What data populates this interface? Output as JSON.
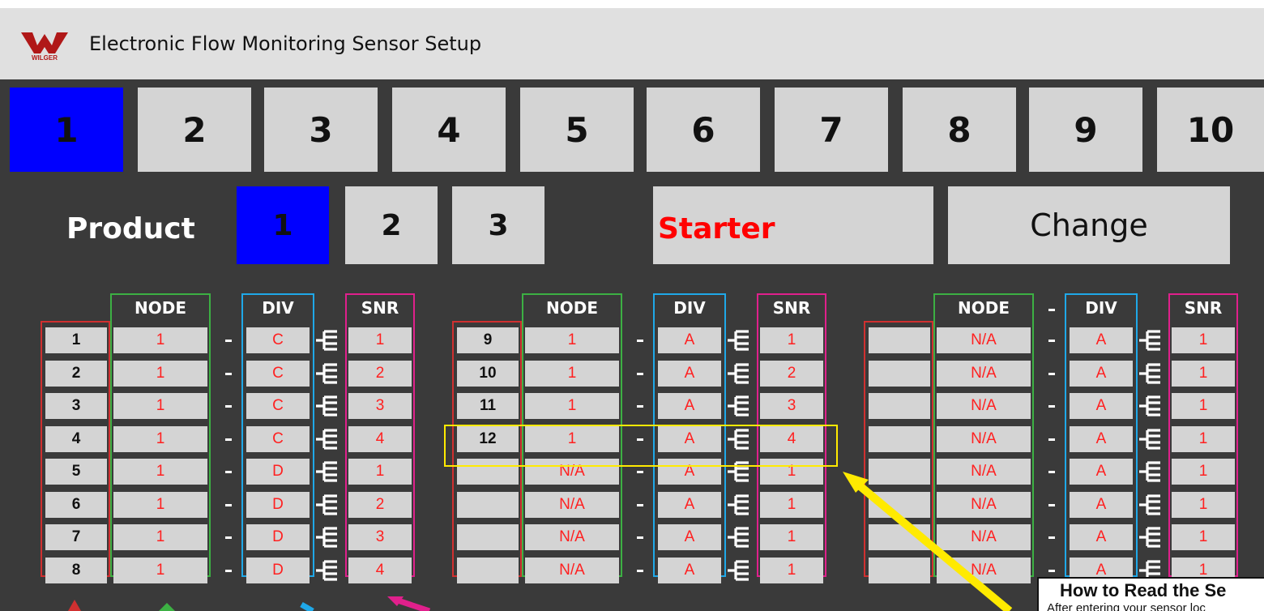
{
  "header": {
    "title": "Electronic Flow Monitoring Sensor Setup",
    "logo_text": "WILGER"
  },
  "tabs": [
    "1",
    "2",
    "3",
    "4",
    "5",
    "6",
    "7",
    "8",
    "9",
    "10"
  ],
  "active_tab": 1,
  "product": {
    "label": "Product",
    "buttons": [
      "1",
      "2",
      "3"
    ],
    "active": 1,
    "name": "Starter",
    "name_color": "#ff0000",
    "change_label": "Change"
  },
  "columns": {
    "node": "NODE",
    "div": "DIV",
    "snr": "SNR"
  },
  "groups": [
    {
      "rows": [
        {
          "row": "1",
          "node": "1",
          "div": "C",
          "snr": "1"
        },
        {
          "row": "2",
          "node": "1",
          "div": "C",
          "snr": "2"
        },
        {
          "row": "3",
          "node": "1",
          "div": "C",
          "snr": "3"
        },
        {
          "row": "4",
          "node": "1",
          "div": "C",
          "snr": "4"
        },
        {
          "row": "5",
          "node": "1",
          "div": "D",
          "snr": "1"
        },
        {
          "row": "6",
          "node": "1",
          "div": "D",
          "snr": "2"
        },
        {
          "row": "7",
          "node": "1",
          "div": "D",
          "snr": "3"
        },
        {
          "row": "8",
          "node": "1",
          "div": "D",
          "snr": "4"
        }
      ]
    },
    {
      "rows": [
        {
          "row": "9",
          "node": "1",
          "div": "A",
          "snr": "1"
        },
        {
          "row": "10",
          "node": "1",
          "div": "A",
          "snr": "2"
        },
        {
          "row": "11",
          "node": "1",
          "div": "A",
          "snr": "3"
        },
        {
          "row": "12",
          "node": "1",
          "div": "A",
          "snr": "4"
        },
        {
          "row": "",
          "node": "N/A",
          "div": "A",
          "snr": "1"
        },
        {
          "row": "",
          "node": "N/A",
          "div": "A",
          "snr": "1"
        },
        {
          "row": "",
          "node": "N/A",
          "div": "A",
          "snr": "1"
        },
        {
          "row": "",
          "node": "N/A",
          "div": "A",
          "snr": "1"
        }
      ]
    },
    {
      "rows": [
        {
          "row": "",
          "node": "N/A",
          "div": "A",
          "snr": "1"
        },
        {
          "row": "",
          "node": "N/A",
          "div": "A",
          "snr": "1"
        },
        {
          "row": "",
          "node": "N/A",
          "div": "A",
          "snr": "1"
        },
        {
          "row": "",
          "node": "N/A",
          "div": "A",
          "snr": "1"
        },
        {
          "row": "",
          "node": "N/A",
          "div": "A",
          "snr": "1"
        },
        {
          "row": "",
          "node": "N/A",
          "div": "A",
          "snr": "1"
        },
        {
          "row": "",
          "node": "N/A",
          "div": "A",
          "snr": "1"
        },
        {
          "row": "",
          "node": "N/A",
          "div": "A",
          "snr": "1"
        }
      ]
    }
  ],
  "callout": {
    "title": "How to Read the Se",
    "text": "After entering your sensor loc"
  },
  "colors": {
    "active_blue": "#0000ff",
    "row_frame": "#d03030",
    "node_frame": "#3cb043",
    "div_frame": "#1fa8e8",
    "snr_frame": "#e0208c",
    "highlight": "#ffea00",
    "value_red": "#ff2020"
  }
}
